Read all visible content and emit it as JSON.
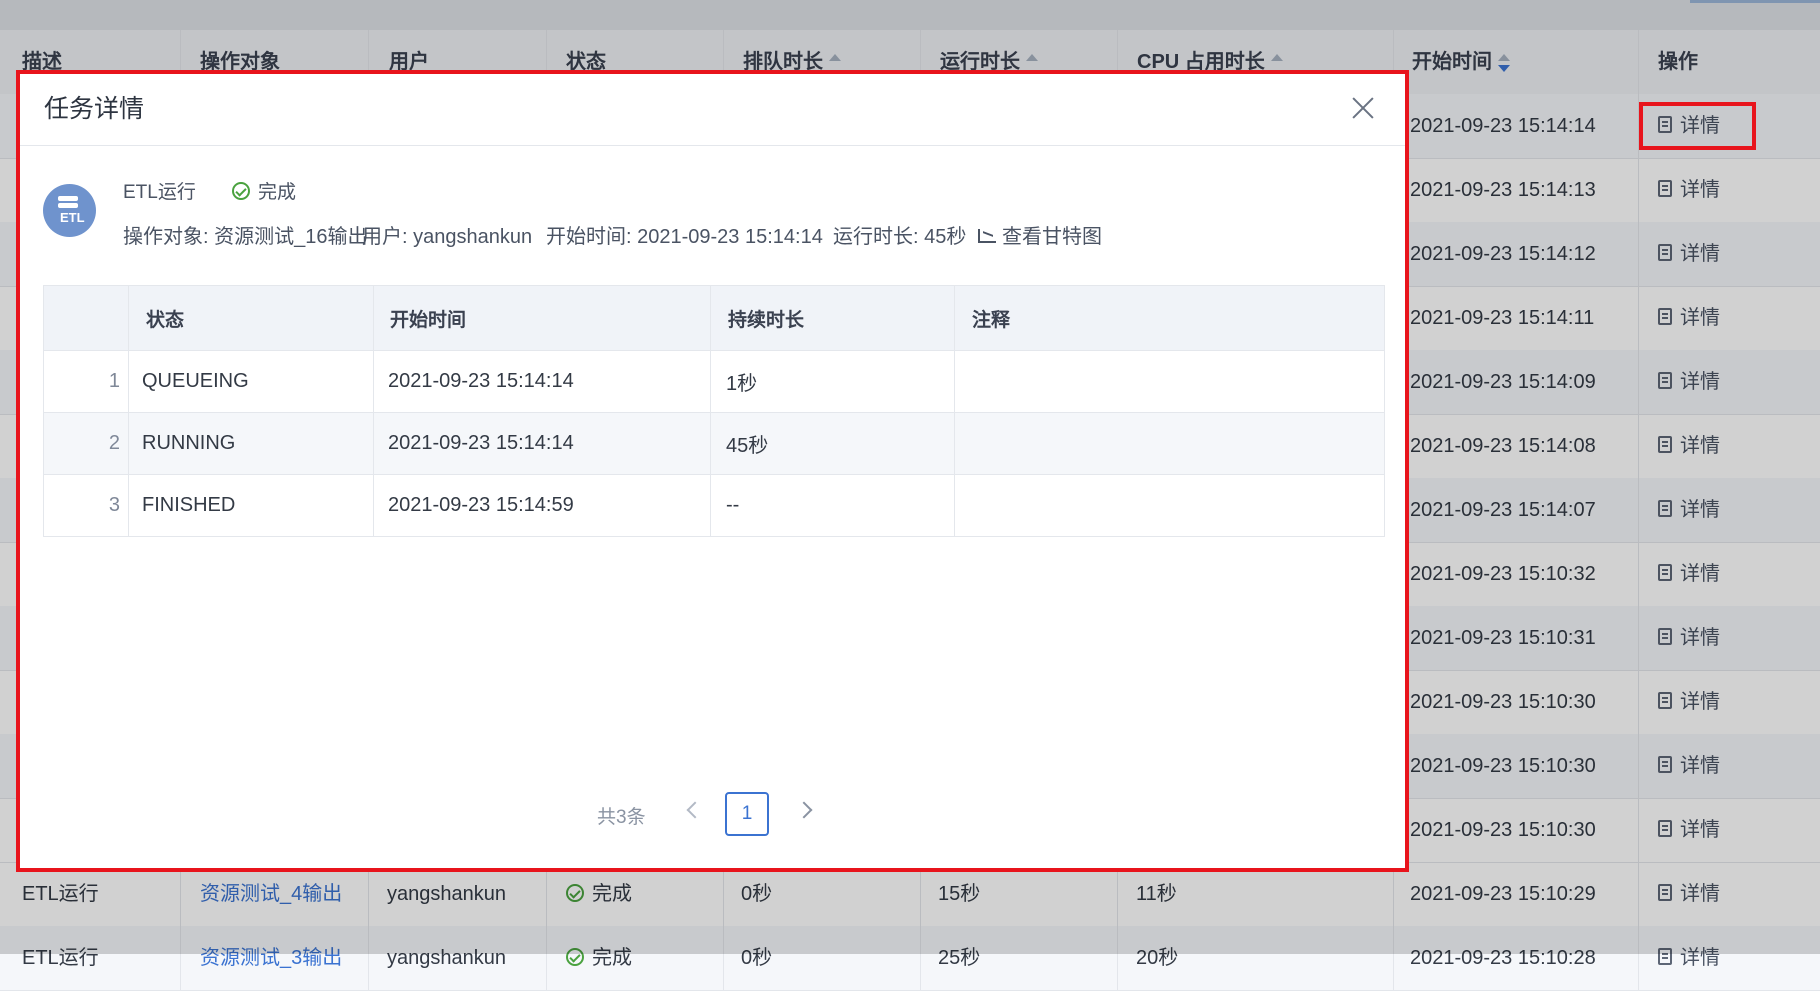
{
  "background_table": {
    "headers": [
      "描述",
      "操作对象",
      "用户",
      "状态",
      "排队时长",
      "运行时长",
      "CPU 占用时长",
      "开始时间",
      "操作"
    ],
    "detail_label": "详情",
    "start_times": [
      "2021-09-23 15:14:14",
      "2021-09-23 15:14:13",
      "2021-09-23 15:14:12",
      "2021-09-23 15:14:11",
      "2021-09-23 15:14:09",
      "2021-09-23 15:14:08",
      "2021-09-23 15:14:07",
      "2021-09-23 15:10:32",
      "2021-09-23 15:10:31",
      "2021-09-23 15:10:30",
      "2021-09-23 15:10:30",
      "2021-09-23 15:10:30"
    ],
    "bottom_row": {
      "description": "ETL运行",
      "target": "资源测试_4输出",
      "user": "yangshankun",
      "status": "完成",
      "queue_time": "0秒",
      "run_time": "15秒",
      "cpu_time": "11秒",
      "start_time": "2021-09-23 15:10:29",
      "action": "详情"
    },
    "cut_row": {
      "description": "ETL运行",
      "target": "资源测试_3输出",
      "user": "yangshankun",
      "status": "完成",
      "queue_time": "0秒",
      "run_time": "25秒",
      "cpu_time": "20秒",
      "start_time": "2021-09-23 15:10:28",
      "action": "详情"
    }
  },
  "modal": {
    "title": "任务详情",
    "avatar_text": "ETL",
    "task_name": "ETL运行",
    "task_status": "完成",
    "target": "操作对象: 资源测试_16输出",
    "user": "用户: yangshankun",
    "start_time": "开始时间: 2021-09-23 15:14:14",
    "duration": "运行时长: 45秒",
    "gantt_link": "查看甘特图",
    "table": {
      "headers": [
        "状态",
        "开始时间",
        "持续时长",
        "注释"
      ],
      "rows": [
        {
          "index": "1",
          "state": "QUEUEING",
          "start": "2021-09-23 15:14:14",
          "duration": "1秒",
          "note": ""
        },
        {
          "index": "2",
          "state": "RUNNING",
          "start": "2021-09-23 15:14:14",
          "duration": "45秒",
          "note": ""
        },
        {
          "index": "3",
          "state": "FINISHED",
          "start": "2021-09-23 15:14:59",
          "duration": "--",
          "note": ""
        }
      ]
    },
    "pagination": {
      "total": "共3条",
      "current_page": "1"
    }
  },
  "colors": {
    "highlight": "#e8141c",
    "accent": "#3b73d1",
    "success": "#4aa23f"
  }
}
